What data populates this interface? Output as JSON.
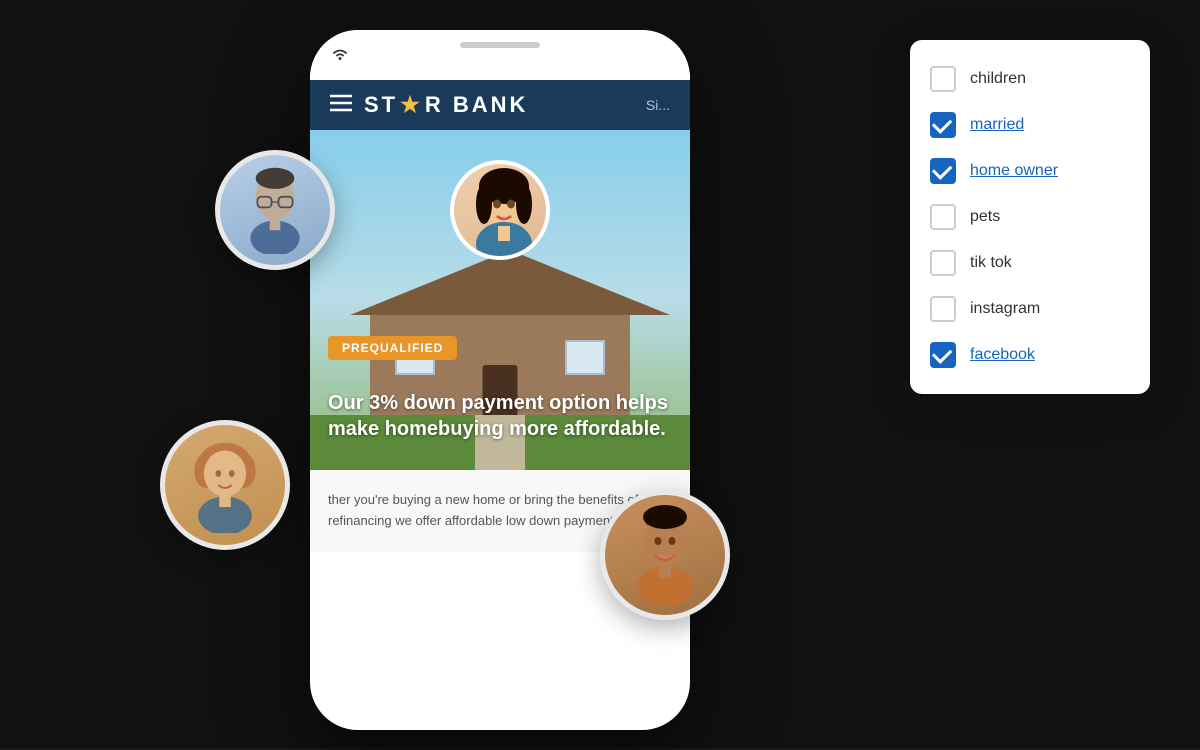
{
  "app": {
    "background_color": "#111111"
  },
  "phone": {
    "logo": "ST★R BANK",
    "logo_text": "STAR BANK",
    "sign_in": "Si...",
    "hero_text": "Our 3% down payment option helps make homebuying more affordable.",
    "prequalified": "PREQUALIFIED",
    "content_text": "ther you're buying a new home or bring the benefits of refinancing we offer affordable low down payments"
  },
  "checkboxes": [
    {
      "id": "children",
      "label": "children",
      "checked": false,
      "underlined": true
    },
    {
      "id": "married",
      "label": "married",
      "checked": true,
      "underlined": true
    },
    {
      "id": "home_owner",
      "label": "home owner",
      "checked": true,
      "underlined": true
    },
    {
      "id": "pets",
      "label": "pets",
      "checked": false,
      "underlined": false
    },
    {
      "id": "tik_tok",
      "label": "tik tok",
      "checked": false,
      "underlined": false
    },
    {
      "id": "instagram",
      "label": "instagram",
      "checked": false,
      "underlined": false
    },
    {
      "id": "facebook",
      "label": "facebook",
      "checked": true,
      "underlined": true
    }
  ]
}
